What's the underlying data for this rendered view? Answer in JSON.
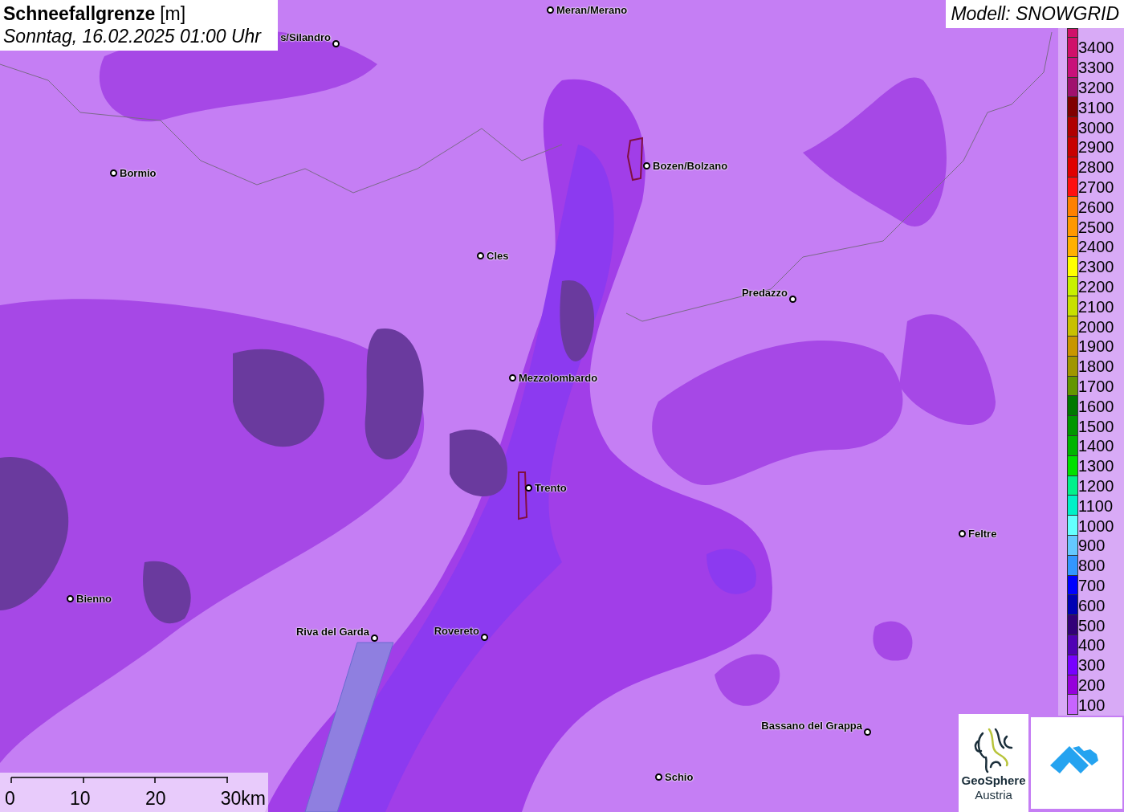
{
  "title": {
    "variable": "Schneefallgrenze",
    "unit": "[m]",
    "datetime": "Sonntag, 16.02.2025 01:00 Uhr"
  },
  "model_label": "Modell: SNOWGRID",
  "cities": [
    {
      "name": "Meran/Merano"
    },
    {
      "name": "s/Silandro"
    },
    {
      "name": "Bormio"
    },
    {
      "name": "Bozen/Bolzano"
    },
    {
      "name": "Cles"
    },
    {
      "name": "Predazzo"
    },
    {
      "name": "Mezzolombardo"
    },
    {
      "name": "Trento"
    },
    {
      "name": "Feltre"
    },
    {
      "name": "Bienno"
    },
    {
      "name": "Riva del Garda"
    },
    {
      "name": "Rovereto"
    },
    {
      "name": "Bassano del Grappa"
    },
    {
      "name": "Schio"
    }
  ],
  "legend": [
    {
      "label": "3400",
      "color": "#d0106a"
    },
    {
      "label": "3300",
      "color": "#c8107a"
    },
    {
      "label": "3200",
      "color": "#a0106e"
    },
    {
      "label": "3100",
      "color": "#800000"
    },
    {
      "label": "3000",
      "color": "#b00000"
    },
    {
      "label": "2900",
      "color": "#c80000"
    },
    {
      "label": "2800",
      "color": "#e00000"
    },
    {
      "label": "2700",
      "color": "#ff1010"
    },
    {
      "label": "2600",
      "color": "#ff8000"
    },
    {
      "label": "2500",
      "color": "#ff9800"
    },
    {
      "label": "2400",
      "color": "#ffb000"
    },
    {
      "label": "2300",
      "color": "#ffff00"
    },
    {
      "label": "2200",
      "color": "#c8f000"
    },
    {
      "label": "2100",
      "color": "#c8e000"
    },
    {
      "label": "2000",
      "color": "#c8c000"
    },
    {
      "label": "1900",
      "color": "#c89600"
    },
    {
      "label": "1800",
      "color": "#a09600"
    },
    {
      "label": "1700",
      "color": "#649600"
    },
    {
      "label": "1600",
      "color": "#007800"
    },
    {
      "label": "1500",
      "color": "#009600"
    },
    {
      "label": "1400",
      "color": "#00b400"
    },
    {
      "label": "1300",
      "color": "#00e000"
    },
    {
      "label": "1200",
      "color": "#00f08c"
    },
    {
      "label": "1100",
      "color": "#00f0c8"
    },
    {
      "label": "1000",
      "color": "#64ffff"
    },
    {
      "label": "900",
      "color": "#64c8ff"
    },
    {
      "label": "800",
      "color": "#3296ff"
    },
    {
      "label": "700",
      "color": "#0000ff"
    },
    {
      "label": "600",
      "color": "#0000b4"
    },
    {
      "label": "500",
      "color": "#320078"
    },
    {
      "label": "400",
      "color": "#5000b4"
    },
    {
      "label": "300",
      "color": "#7800ff"
    },
    {
      "label": "200",
      "color": "#9600dc"
    },
    {
      "label": "100",
      "color": "#c864ff"
    }
  ],
  "scale_bar": {
    "ticks": [
      "0",
      "10",
      "20",
      "30km"
    ]
  },
  "logos": {
    "geosphere": {
      "line1": "GeoSphere",
      "line2": "Austria"
    }
  }
}
